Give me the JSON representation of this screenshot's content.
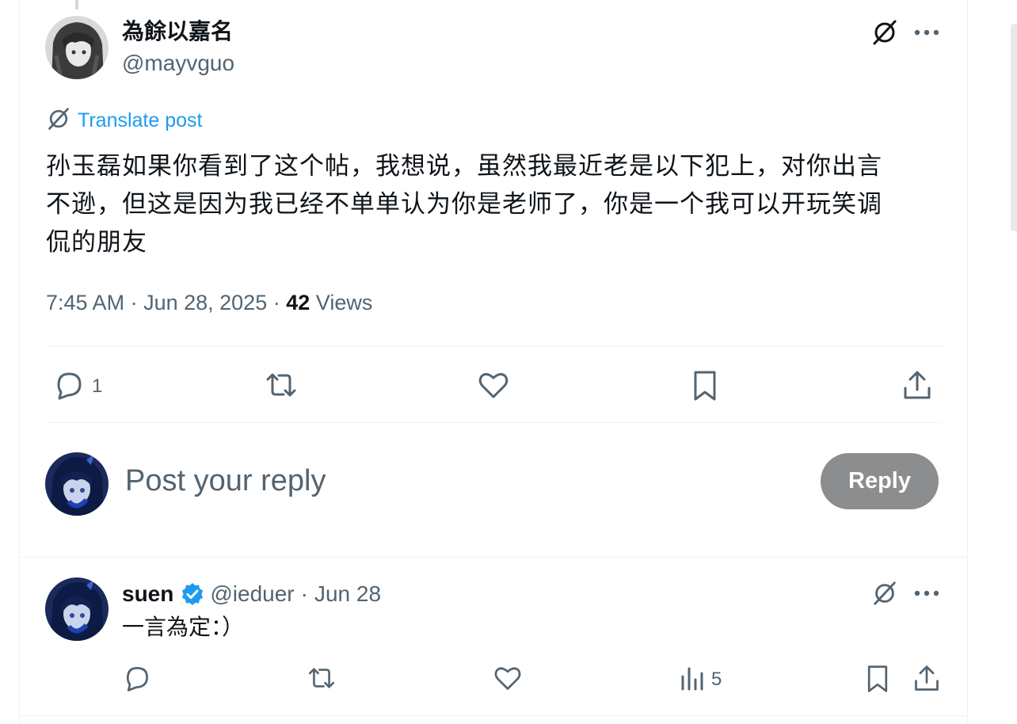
{
  "post": {
    "author_name": "為餘以嘉名",
    "author_handle": "@mayvguo",
    "translate_label": "Translate post",
    "text_lines": [
      "孙玉磊如果你看到了这个帖，我想说，虽然我最近老是以下犯上，对你出言",
      "不逊，但这是因为我已经不单单认为你是老师了，你是一个我可以开玩笑调",
      "侃的朋友"
    ],
    "time": "7:45 AM",
    "date": "Jun 28, 2025",
    "views_count": "42",
    "views_label": "Views",
    "reply_count": "1",
    "icons": [
      "grok-icon",
      "more-icon",
      "translate-icon",
      "reply-icon",
      "repost-icon",
      "like-icon",
      "bookmark-icon",
      "share-icon"
    ]
  },
  "composer": {
    "placeholder": "Post your reply",
    "button_label": "Reply"
  },
  "reply": {
    "author_name": "suen",
    "author_handle": "@ieduer",
    "separator": "·",
    "date": "Jun 28",
    "text": "一言為定：）",
    "views_count": "5",
    "verified": true
  },
  "colors": {
    "link": "#1d9bf0",
    "muted": "#536471",
    "text": "#0f1419",
    "reply_button": "#8b8d8f",
    "divider": "#eff3f4"
  }
}
